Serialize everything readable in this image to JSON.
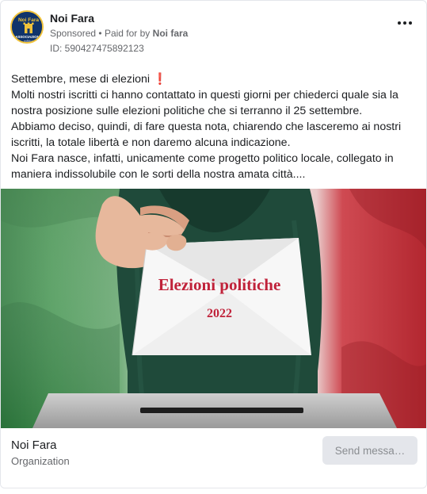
{
  "post": {
    "page_name": "Noi Fara",
    "sponsored": "Sponsored",
    "separator": "•",
    "paid_prefix": "Paid for by",
    "paid_by": "Noi fara",
    "ad_id": "ID: 590427475892123",
    "text": {
      "line1": "Settembre, mese di elezioni",
      "line1_emoji": "❗",
      "para1": "Molti nostri iscritti ci hanno contattato in questi giorni per chiederci quale sia la nostra posizione sulle elezioni politiche che si terranno il 25 settembre.",
      "para2": "Abbiamo deciso, quindi, di fare questa nota, chiarendo che lasceremo ai nostri iscritti, la totale libertà e non daremo alcuna indicazione.",
      "para3": "Noi Fara nasce, infatti, unicamente come progetto politico locale, collegato in maniera indissolubile con le sorti della nostra amata città...."
    },
    "avatar": {
      "top_text": "Noi Fara",
      "bottom_text": "ASSOCIAZIONE",
      "sub_text": "politica",
      "colors": {
        "bg": "#10346b",
        "ring": "#f0c23a",
        "tower": "#f0c23a"
      }
    },
    "image": {
      "envelope_title": "Elezioni politiche",
      "envelope_year": "2022",
      "colors": {
        "green": "#3b8a4a",
        "white": "#f2f2f2",
        "red": "#c4323b",
        "dress": "#1f4a3a",
        "title": "#c0223a"
      }
    }
  },
  "footer": {
    "name": "Noi Fara",
    "category": "Organization",
    "cta_label": "Send messa…"
  }
}
